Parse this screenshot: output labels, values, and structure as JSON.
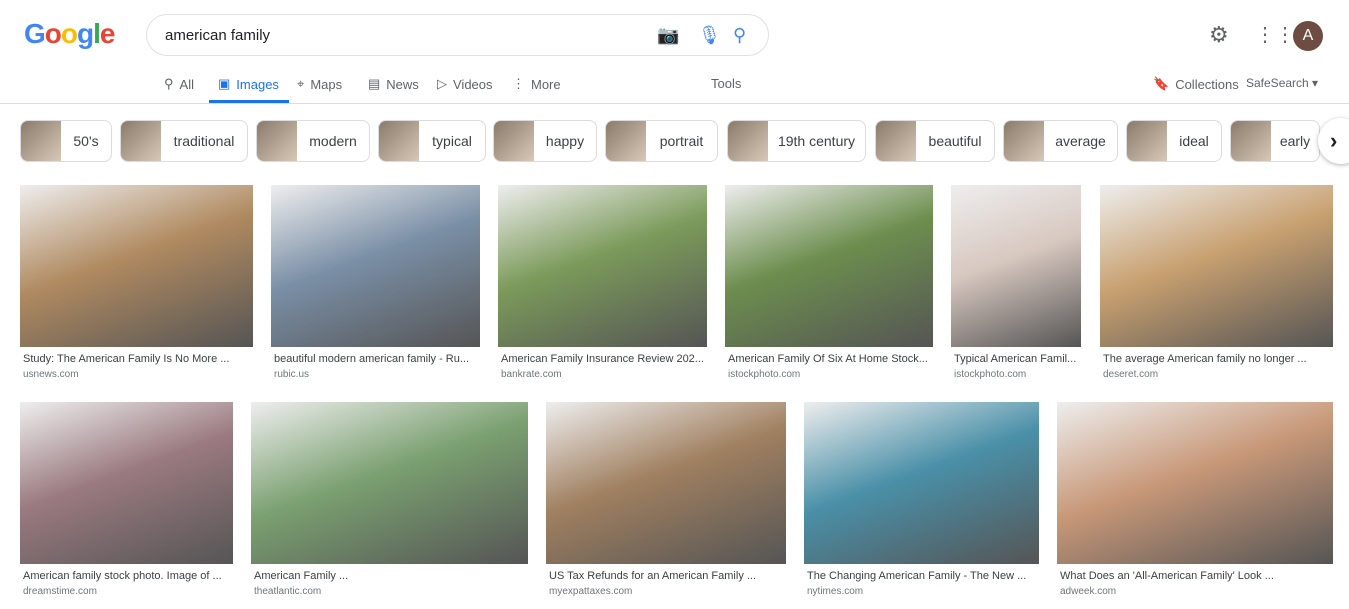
{
  "logo": "Google",
  "search": {
    "query": "american family"
  },
  "tabs": [
    {
      "label": "All",
      "icon": "search-icon"
    },
    {
      "label": "Images",
      "icon": "image-icon"
    },
    {
      "label": "Maps",
      "icon": "pin-icon"
    },
    {
      "label": "News",
      "icon": "news-icon"
    },
    {
      "label": "Videos",
      "icon": "play-icon"
    },
    {
      "label": "More",
      "icon": "more-icon"
    }
  ],
  "tools": "Tools",
  "collections": "Collections",
  "safesearch": "SafeSearch ▾",
  "avatar": "A",
  "chips": [
    "50's",
    "traditional",
    "modern",
    "typical",
    "happy",
    "portrait",
    "19th century",
    "beautiful",
    "average",
    "ideal",
    "early"
  ],
  "results": [
    {
      "title": "Study: The American Family Is No More ...",
      "source": "usnews.com",
      "color": "#b08a60"
    },
    {
      "title": "beautiful modern american family - Ru...",
      "source": "rubic.us",
      "color": "#7a8fa6"
    },
    {
      "title": "American Family Insurance Review 202...",
      "source": "bankrate.com",
      "color": "#7b9a5a"
    },
    {
      "title": "American Family Of Six At Home Stock...",
      "source": "istockphoto.com",
      "color": "#6c8e4e"
    },
    {
      "title": "Typical American Famil...",
      "source": "istockphoto.com",
      "color": "#d8c8c0"
    },
    {
      "title": "The average American family no longer ...",
      "source": "deseret.com",
      "color": "#c8a070"
    },
    {
      "title": "American family stock photo. Image of ...",
      "source": "dreamstime.com",
      "color": "#9a7a80"
    },
    {
      "title": "American Family ...",
      "source": "theatlantic.com",
      "color": "#7aa070"
    },
    {
      "title": "US Tax Refunds for an American Family ...",
      "source": "myexpattaxes.com",
      "color": "#a08060"
    },
    {
      "title": "The Changing American Family - The New ...",
      "source": "nytimes.com",
      "color": "#4a90a8"
    },
    {
      "title": "What Does an 'All-American Family' Look ...",
      "source": "adweek.com",
      "color": "#c89878"
    }
  ]
}
